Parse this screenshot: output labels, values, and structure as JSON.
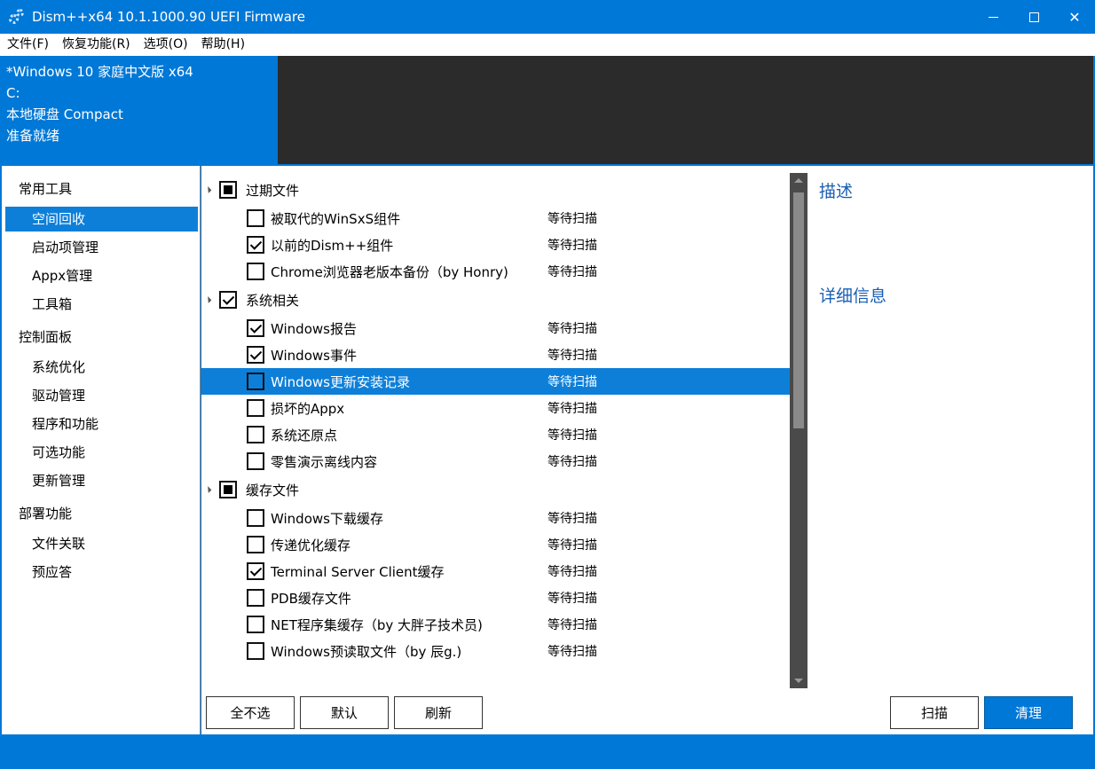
{
  "window": {
    "title": "Dism++x64 10.1.1000.90 UEFI Firmware",
    "accent": "#0078d7",
    "controls": {
      "min": "",
      "max": "",
      "close": "✕"
    }
  },
  "menu": [
    "文件(F)",
    "恢复功能(R)",
    "选项(O)",
    "帮助(H)"
  ],
  "info": {
    "os": "*Windows 10 家庭中文版 x64",
    "drive": "C:",
    "disk": "本地硬盘 Compact",
    "status": "准备就绪"
  },
  "sidebar": {
    "groups": [
      {
        "label": "常用工具",
        "items": [
          "空间回收",
          "启动项管理",
          "Appx管理",
          "工具箱"
        ]
      },
      {
        "label": "控制面板",
        "items": [
          "系统优化",
          "驱动管理",
          "程序和功能",
          "可选功能",
          "更新管理"
        ]
      },
      {
        "label": "部署功能",
        "items": [
          "文件关联",
          "预应答"
        ]
      }
    ],
    "active": "空间回收"
  },
  "list": {
    "categories": [
      {
        "label": "过期文件",
        "state": "partial",
        "items": [
          {
            "label": "被取代的WinSxS组件",
            "checked": false,
            "status": "等待扫描"
          },
          {
            "label": "以前的Dism++组件",
            "checked": true,
            "status": "等待扫描"
          },
          {
            "label": "Chrome浏览器老版本备份（by Honry)",
            "checked": false,
            "status": "等待扫描"
          }
        ]
      },
      {
        "label": "系统相关",
        "state": "checked",
        "items": [
          {
            "label": "Windows报告",
            "checked": true,
            "status": "等待扫描"
          },
          {
            "label": "Windows事件",
            "checked": true,
            "status": "等待扫描"
          },
          {
            "label": "Windows更新安装记录",
            "checked": false,
            "status": "等待扫描",
            "selected": true
          },
          {
            "label": "损坏的Appx",
            "checked": false,
            "status": "等待扫描"
          },
          {
            "label": "系统还原点",
            "checked": false,
            "status": "等待扫描"
          },
          {
            "label": "零售演示离线内容",
            "checked": false,
            "status": "等待扫描"
          }
        ]
      },
      {
        "label": "缓存文件",
        "state": "partial",
        "items": [
          {
            "label": "Windows下载缓存",
            "checked": false,
            "status": "等待扫描"
          },
          {
            "label": "传递优化缓存",
            "checked": false,
            "status": "等待扫描"
          },
          {
            "label": "Terminal Server Client缓存",
            "checked": true,
            "status": "等待扫描"
          },
          {
            "label": "PDB缓存文件",
            "checked": false,
            "status": "等待扫描"
          },
          {
            "label": "NET程序集缓存（by 大胖子技术员)",
            "checked": false,
            "status": "等待扫描"
          },
          {
            "label": "Windows预读取文件（by 辰g.)",
            "checked": false,
            "status": "等待扫描"
          }
        ]
      }
    ]
  },
  "right": {
    "desc_title": "描述",
    "detail_title": "详细信息"
  },
  "buttons": {
    "select_none": "全不选",
    "default": "默认",
    "refresh": "刷新",
    "scan": "扫描",
    "clean": "清理"
  }
}
